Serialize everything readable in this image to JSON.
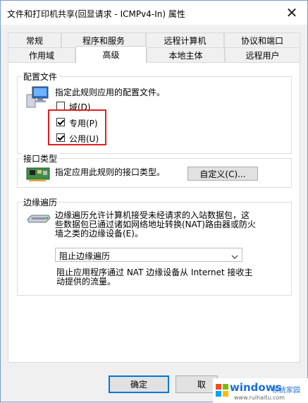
{
  "window": {
    "title": "文件和打印机共享(回显请求 - ICMPv4-In) 属性",
    "close_glyph": "✕"
  },
  "tabs_row1": [
    "常规",
    "程序和服务",
    "远程计算机",
    "协议和端口"
  ],
  "tabs_row2": [
    "作用域",
    "高级",
    "本地主体",
    "远程用户"
  ],
  "active_tab": "高级",
  "profiles": {
    "group_label": "配置文件",
    "description": "指定此规则应用的配置文件。",
    "domain": {
      "label": "域(D)",
      "checked": false
    },
    "private": {
      "label": "专用(P)",
      "checked": true
    },
    "public": {
      "label": "公用(U)",
      "checked": true
    }
  },
  "interface": {
    "group_label": "接口类型",
    "description": "指定应用此规则的接口类型。",
    "customize_label": "自定义(C)..."
  },
  "edge": {
    "group_label": "边缘遍历",
    "description_lines": [
      "边缘遍历允许计算机接受未经请求的入站数据包，这",
      "些数据包已通过诸如网络地址转换(NAT)路由器或防火",
      "墙之类的边缘设备(E)。"
    ],
    "selected_option": "阻止边缘遍历",
    "option_description_lines": [
      "阻止应用程序通过 NAT 边缘设备从 Internet 接收主",
      "动提供的流量。"
    ]
  },
  "buttons": {
    "ok": "确定",
    "cancel": "取"
  },
  "watermark": {
    "brand": "windows",
    "suffix": "系统家园",
    "url": "www.ruihaitu.com"
  },
  "colors": {
    "highlight": "#e02020",
    "accent": "#0078d7",
    "brand_blue": "#1c6ed8"
  }
}
